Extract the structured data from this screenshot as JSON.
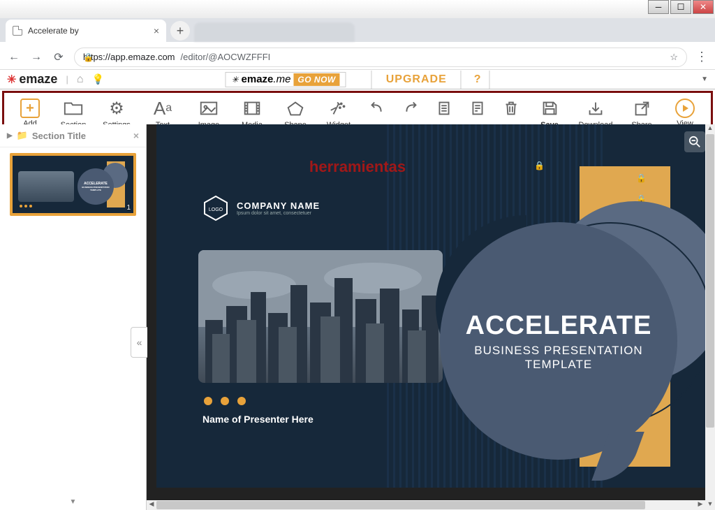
{
  "browser": {
    "tab_title": "Accelerate by",
    "url_host": "https://app.emaze.com",
    "url_path": "/editor/@AOCWZFFFI"
  },
  "app_header": {
    "logo": "emaze",
    "emaze_me": "emaze.me",
    "go_now": "GO NOW",
    "upgrade": "UPGRADE",
    "help": "?"
  },
  "toolbar": {
    "add": "Add",
    "section": "Section",
    "settings": "Settings",
    "text": "Text",
    "image": "Image",
    "media": "Media",
    "shape": "Shape",
    "widget": "Widget",
    "save": "Save",
    "download": "Download",
    "share": "Share",
    "view": "View"
  },
  "annotation": "herramientas",
  "sidebar": {
    "section_title": "Section Title",
    "slide_number": "1"
  },
  "slide": {
    "company_name": "COMPANY NAME",
    "company_tag": "Ipsum dolor sit amet, consectetuer",
    "title": "ACCELERATE",
    "subtitle1": "BUSINESS PRESENTATION",
    "subtitle2": "TEMPLATE",
    "presenter": "Name of Presenter Here",
    "thumb_title": "ACCELERATE",
    "thumb_sub1": "BUSINESS PRESENTATION",
    "thumb_sub2": "TEMPLATE"
  }
}
